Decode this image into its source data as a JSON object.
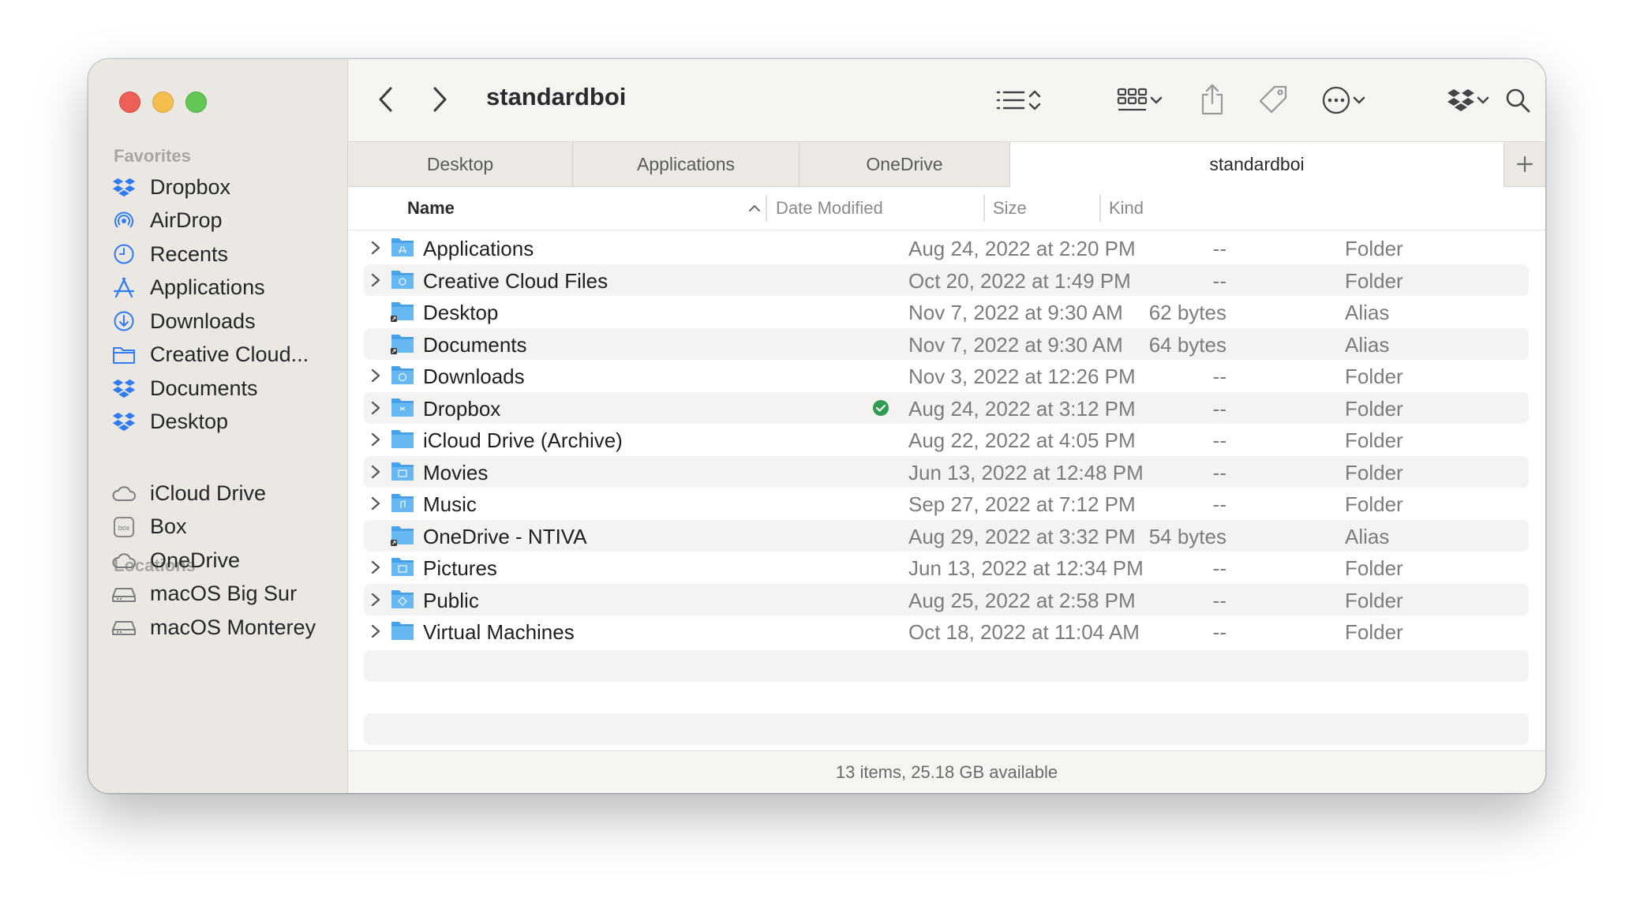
{
  "window": {
    "title": "standardboi"
  },
  "sidebar": {
    "favorites_title": "Favorites",
    "favorites": [
      {
        "label": "Dropbox",
        "icon": "dropbox-icon"
      },
      {
        "label": "AirDrop",
        "icon": "airdrop-icon"
      },
      {
        "label": "Recents",
        "icon": "clock-icon"
      },
      {
        "label": "Applications",
        "icon": "applications-icon"
      },
      {
        "label": "Downloads",
        "icon": "download-icon"
      },
      {
        "label": "Creative Cloud...",
        "icon": "folder-icon"
      },
      {
        "label": "Documents",
        "icon": "dropbox-icon"
      },
      {
        "label": "Desktop",
        "icon": "dropbox-icon"
      }
    ],
    "locations_title": "Locations",
    "locations": [
      {
        "label": "iCloud Drive",
        "icon": "cloud-icon"
      },
      {
        "label": "Box",
        "icon": "box-icon"
      },
      {
        "label": "OneDrive",
        "icon": "cloud-icon"
      },
      {
        "label": "macOS Big Sur",
        "icon": "disk-icon"
      },
      {
        "label": "macOS Monterey",
        "icon": "disk-icon"
      }
    ],
    "box_icon_text": "box"
  },
  "tabs": [
    "Desktop",
    "Applications",
    "OneDrive",
    "standardboi"
  ],
  "active_tab": 3,
  "columns": {
    "name": "Name",
    "date": "Date Modified",
    "size": "Size",
    "kind": "Kind"
  },
  "files": [
    {
      "name": "Applications",
      "date": "Aug 24, 2022 at 2:20 PM",
      "size": "--",
      "kind": "Folder",
      "expandable": true
    },
    {
      "name": "Creative Cloud Files",
      "date": "Oct 20, 2022 at 1:49 PM",
      "size": "--",
      "kind": "Folder",
      "expandable": true
    },
    {
      "name": "Desktop",
      "date": "Nov 7, 2022 at 9:30 AM",
      "size": "62 bytes",
      "kind": "Alias",
      "expandable": false
    },
    {
      "name": "Documents",
      "date": "Nov 7, 2022 at 9:30 AM",
      "size": "64 bytes",
      "kind": "Alias",
      "expandable": false
    },
    {
      "name": "Downloads",
      "date": "Nov 3, 2022 at 12:26 PM",
      "size": "--",
      "kind": "Folder",
      "expandable": true
    },
    {
      "name": "Dropbox",
      "date": "Aug 24, 2022 at 3:12 PM",
      "size": "--",
      "kind": "Folder",
      "expandable": true,
      "synced": true
    },
    {
      "name": "iCloud Drive (Archive)",
      "date": "Aug 22, 2022 at 4:05 PM",
      "size": "--",
      "kind": "Folder",
      "expandable": true
    },
    {
      "name": "Movies",
      "date": "Jun 13, 2022 at 12:48 PM",
      "size": "--",
      "kind": "Folder",
      "expandable": true
    },
    {
      "name": "Music",
      "date": "Sep 27, 2022 at 7:12 PM",
      "size": "--",
      "kind": "Folder",
      "expandable": true
    },
    {
      "name": "OneDrive - NTIVA",
      "date": "Aug 29, 2022 at 3:32 PM",
      "size": "54 bytes",
      "kind": "Alias",
      "expandable": false
    },
    {
      "name": "Pictures",
      "date": "Jun 13, 2022 at 12:34 PM",
      "size": "--",
      "kind": "Folder",
      "expandable": true
    },
    {
      "name": "Public",
      "date": "Aug 25, 2022 at 2:58 PM",
      "size": "--",
      "kind": "Folder",
      "expandable": true
    },
    {
      "name": "Virtual Machines",
      "date": "Oct 18, 2022 at 11:04 AM",
      "size": "--",
      "kind": "Folder",
      "expandable": true
    }
  ],
  "status": {
    "text": "13 items, 25.18 GB available"
  },
  "colors": {
    "accent": "#2f7cf6",
    "folder": "#5eb2f0",
    "synced": "#2e9d4f"
  }
}
